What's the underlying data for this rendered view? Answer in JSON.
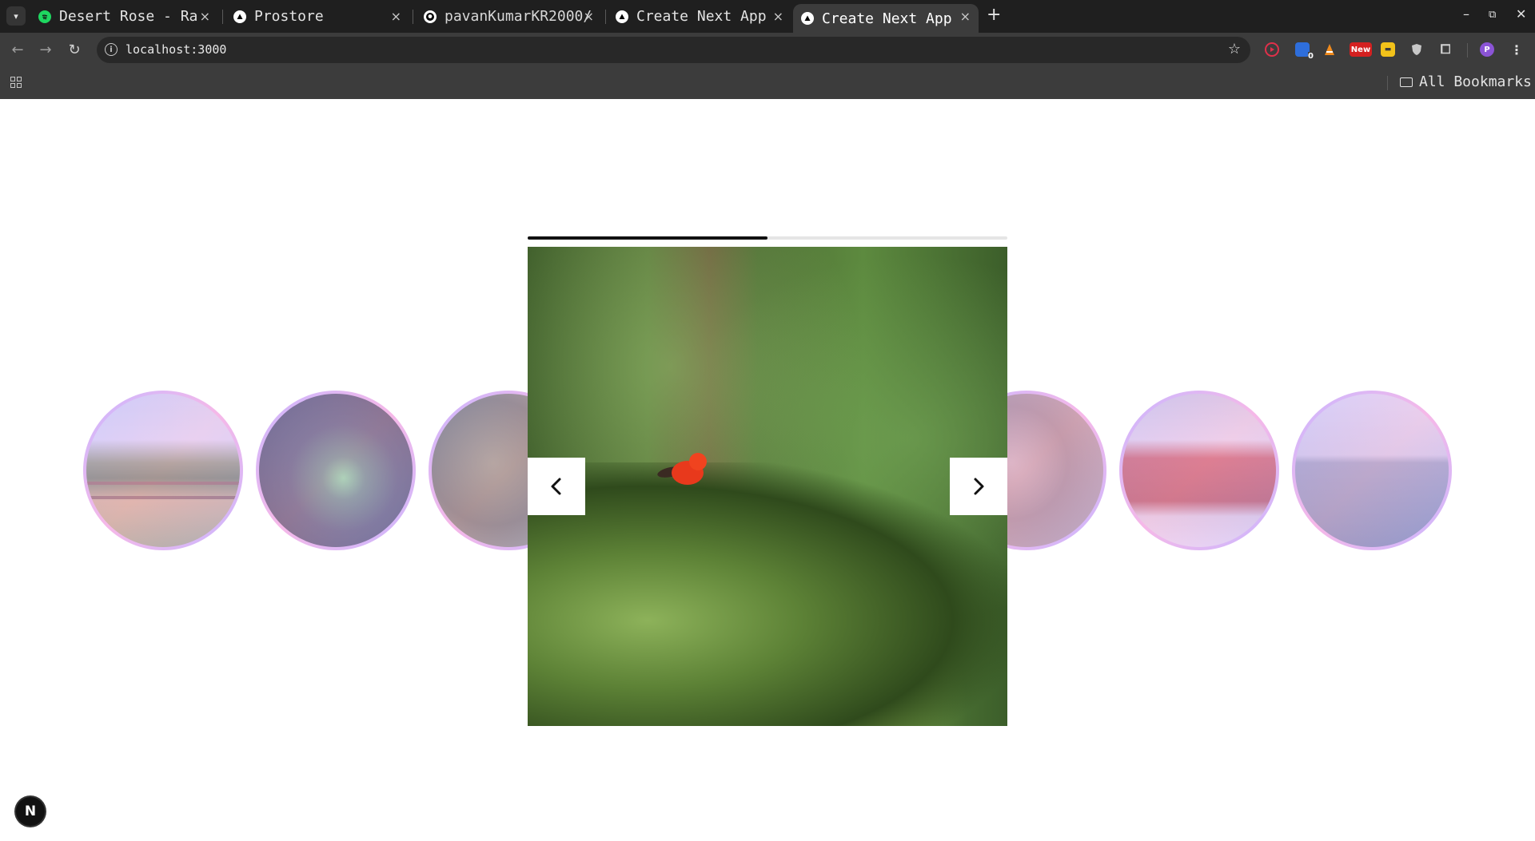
{
  "browser": {
    "tabs": [
      {
        "title": "Desert Rose - Ra",
        "favicon": "spotify-icon",
        "active": false
      },
      {
        "title": "Prostore",
        "favicon": "nextjs-icon",
        "active": false
      },
      {
        "title": "pavanKumarKR2000/",
        "favicon": "github-icon",
        "active": false
      },
      {
        "title": "Create Next App",
        "favicon": "nextjs-icon",
        "active": false
      },
      {
        "title": "Create Next App",
        "favicon": "nextjs-icon",
        "active": true
      }
    ],
    "new_tab_label": "+",
    "close_glyph": "×",
    "url": "localhost:3000",
    "bookmarks_label": "All Bookmarks",
    "profile_initial": "P",
    "extensions": [
      "record-icon",
      "counter-extension-icon",
      "vlc-icon",
      "new-badge-extension-icon",
      "wallet-icon",
      "shield-extension-icon",
      "puzzle-icon"
    ],
    "extension_badge": "0",
    "new_badge_text": "New"
  },
  "page": {
    "progress": 0.5,
    "accent_color": "#111111",
    "thumbnails": [
      {
        "subject": "meadow-with-fence"
      },
      {
        "subject": "northern-lights"
      },
      {
        "subject": "red-bird-on-branch"
      },
      {
        "subject": "cat-face"
      },
      {
        "subject": "red-train-at-station"
      },
      {
        "subject": "sailboat-on-sea"
      }
    ],
    "main_image_subject": "red-bird-on-branch",
    "prev_icon": "chevron-left-icon",
    "next_icon": "chevron-right-icon",
    "dev_badge_label": "N"
  }
}
